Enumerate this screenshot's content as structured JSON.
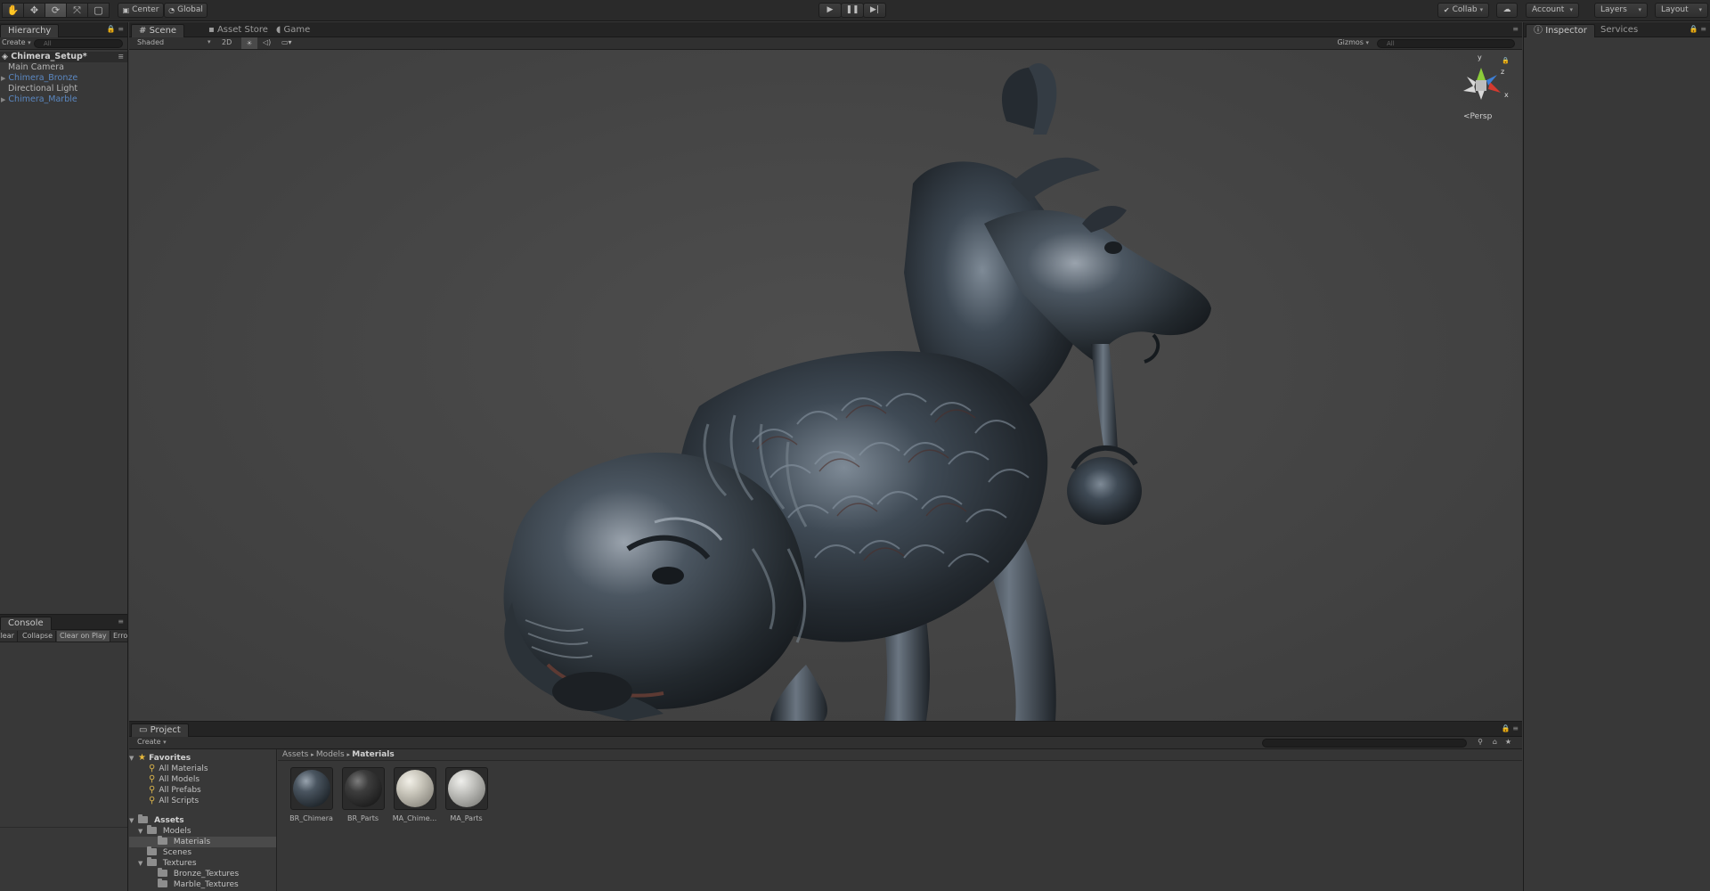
{
  "toolbar": {
    "tools": [
      "hand",
      "move",
      "rotate",
      "scale",
      "rect"
    ],
    "pivot_mode": "Center",
    "pivot_rotation": "Global",
    "collab": "Collab",
    "account": "Account",
    "layers": "Layers",
    "layout": "Layout"
  },
  "hierarchy": {
    "tab": "Hierarchy",
    "create": "Create",
    "search_placeholder": "All",
    "scene": "Chimera_Setup*",
    "items": [
      "Main Camera",
      "Chimera_Bronze",
      "Directional Light",
      "Chimera_Marble"
    ]
  },
  "console": {
    "tab": "Console",
    "buttons": [
      "Clear",
      "Collapse",
      "Clear on Play",
      "Error Pause"
    ]
  },
  "scene": {
    "tabs": [
      "Scene",
      "Asset Store",
      "Game"
    ],
    "shading": "Shaded",
    "mode_2d": "2D",
    "gizmos": "Gizmos",
    "search_placeholder": "All",
    "projection": "Persp",
    "axes": {
      "x": "x",
      "y": "y",
      "z": "z"
    },
    "colors": {
      "x_axis": "#d43a2f",
      "y_axis": "#8ccc3a",
      "z_axis": "#3d7fd6"
    }
  },
  "project": {
    "tab": "Project",
    "create": "Create",
    "favorites": "Favorites",
    "favorite_items": [
      "All Materials",
      "All Models",
      "All Prefabs",
      "All Scripts"
    ],
    "assets_root": "Assets",
    "folders": {
      "models": "Models",
      "materials": "Materials",
      "scenes": "Scenes",
      "textures": "Textures",
      "bronze_textures": "Bronze_Textures",
      "marble_textures": "Marble_Textures"
    },
    "breadcrumb": [
      "Assets",
      "Models",
      "Materials"
    ],
    "assets": [
      "BR_Chimera",
      "BR_Parts",
      "MA_Chime...",
      "MA_Parts"
    ]
  },
  "inspector": {
    "tabs": [
      "Inspector",
      "Services"
    ]
  }
}
